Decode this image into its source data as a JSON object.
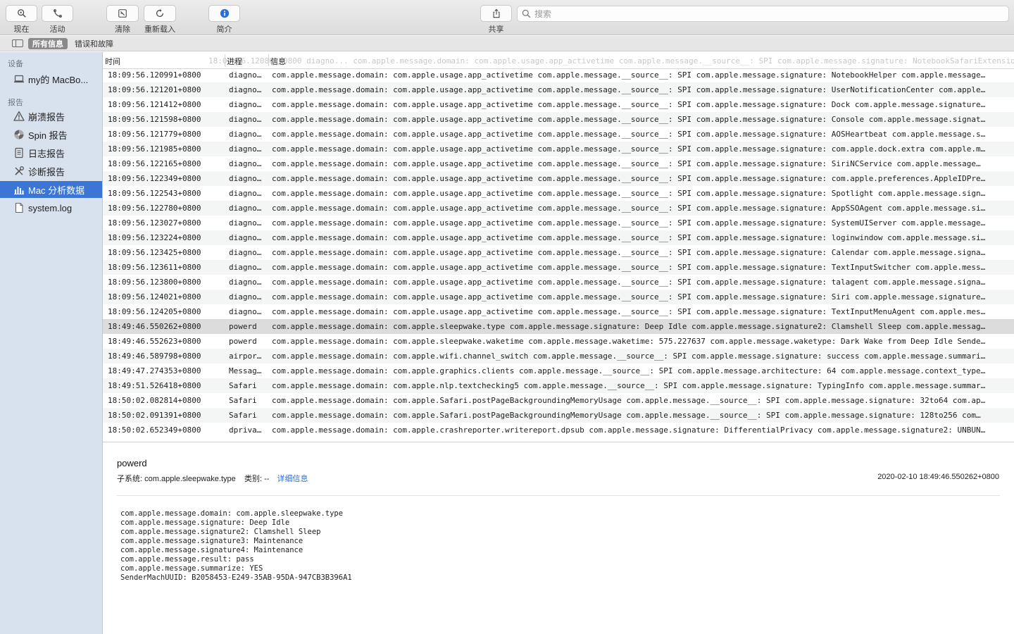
{
  "toolbar": {
    "now_label": "现在",
    "activity_label": "活动",
    "clear_label": "清除",
    "reload_label": "重新载入",
    "info_label": "简介",
    "share_label": "共享",
    "search_placeholder": "搜索"
  },
  "filterbar": {
    "all_label": "所有信息",
    "errors_label": "错误和故障"
  },
  "sidebar": {
    "devices_heading": "设备",
    "device_name": "my的 MacBo...",
    "reports_heading": "报告",
    "items": [
      {
        "label": "崩溃报告",
        "icon": "warning-icon"
      },
      {
        "label": "Spin 报告",
        "icon": "spin-icon"
      },
      {
        "label": "日志报告",
        "icon": "log-icon"
      },
      {
        "label": "诊断报告",
        "icon": "tools-icon"
      },
      {
        "label": "Mac 分析数据",
        "icon": "chart-icon"
      },
      {
        "label": "system.log",
        "icon": "document-icon"
      }
    ],
    "selected_index": 4
  },
  "table": {
    "headers": {
      "time": "时间",
      "process": "进程",
      "message": "信息"
    },
    "ghost_row": "18:09:56.120800+0800  diagno...  com.apple.message.domain: com.apple.usage.app_activetime com.apple.message.__source__: SPI com.apple.message.signature: NotebookSafariExtension com.appl...",
    "rows": [
      {
        "time": "18:09:56.120991+0800",
        "process": "diagno…",
        "message": "com.apple.message.domain: com.apple.usage.app_activetime com.apple.message.__source__: SPI com.apple.message.signature: NotebookHelper com.apple.message…"
      },
      {
        "time": "18:09:56.121201+0800",
        "process": "diagno…",
        "message": "com.apple.message.domain: com.apple.usage.app_activetime com.apple.message.__source__: SPI com.apple.message.signature: UserNotificationCenter com.apple…"
      },
      {
        "time": "18:09:56.121412+0800",
        "process": "diagno…",
        "message": "com.apple.message.domain: com.apple.usage.app_activetime com.apple.message.__source__: SPI com.apple.message.signature: Dock com.apple.message.signature…"
      },
      {
        "time": "18:09:56.121598+0800",
        "process": "diagno…",
        "message": "com.apple.message.domain: com.apple.usage.app_activetime com.apple.message.__source__: SPI com.apple.message.signature: Console com.apple.message.signat…"
      },
      {
        "time": "18:09:56.121779+0800",
        "process": "diagno…",
        "message": "com.apple.message.domain: com.apple.usage.app_activetime com.apple.message.__source__: SPI com.apple.message.signature: AOSHeartbeat com.apple.message.s…"
      },
      {
        "time": "18:09:56.121985+0800",
        "process": "diagno…",
        "message": "com.apple.message.domain: com.apple.usage.app_activetime com.apple.message.__source__: SPI com.apple.message.signature: com.apple.dock.extra com.apple.m…"
      },
      {
        "time": "18:09:56.122165+0800",
        "process": "diagno…",
        "message": "com.apple.message.domain: com.apple.usage.app_activetime com.apple.message.__source__: SPI com.apple.message.signature: SiriNCService com.apple.message…"
      },
      {
        "time": "18:09:56.122349+0800",
        "process": "diagno…",
        "message": "com.apple.message.domain: com.apple.usage.app_activetime com.apple.message.__source__: SPI com.apple.message.signature: com.apple.preferences.AppleIDPre…"
      },
      {
        "time": "18:09:56.122543+0800",
        "process": "diagno…",
        "message": "com.apple.message.domain: com.apple.usage.app_activetime com.apple.message.__source__: SPI com.apple.message.signature: Spotlight com.apple.message.sign…"
      },
      {
        "time": "18:09:56.122780+0800",
        "process": "diagno…",
        "message": "com.apple.message.domain: com.apple.usage.app_activetime com.apple.message.__source__: SPI com.apple.message.signature: AppSSOAgent com.apple.message.si…"
      },
      {
        "time": "18:09:56.123027+0800",
        "process": "diagno…",
        "message": "com.apple.message.domain: com.apple.usage.app_activetime com.apple.message.__source__: SPI com.apple.message.signature: SystemUIServer com.apple.message…"
      },
      {
        "time": "18:09:56.123224+0800",
        "process": "diagno…",
        "message": "com.apple.message.domain: com.apple.usage.app_activetime com.apple.message.__source__: SPI com.apple.message.signature: loginwindow com.apple.message.si…"
      },
      {
        "time": "18:09:56.123425+0800",
        "process": "diagno…",
        "message": "com.apple.message.domain: com.apple.usage.app_activetime com.apple.message.__source__: SPI com.apple.message.signature: Calendar com.apple.message.signa…"
      },
      {
        "time": "18:09:56.123611+0800",
        "process": "diagno…",
        "message": "com.apple.message.domain: com.apple.usage.app_activetime com.apple.message.__source__: SPI com.apple.message.signature: TextInputSwitcher com.apple.mess…"
      },
      {
        "time": "18:09:56.123800+0800",
        "process": "diagno…",
        "message": "com.apple.message.domain: com.apple.usage.app_activetime com.apple.message.__source__: SPI com.apple.message.signature: talagent com.apple.message.signa…"
      },
      {
        "time": "18:09:56.124021+0800",
        "process": "diagno…",
        "message": "com.apple.message.domain: com.apple.usage.app_activetime com.apple.message.__source__: SPI com.apple.message.signature: Siri com.apple.message.signature…"
      },
      {
        "time": "18:09:56.124205+0800",
        "process": "diagno…",
        "message": "com.apple.message.domain: com.apple.usage.app_activetime com.apple.message.__source__: SPI com.apple.message.signature: TextInputMenuAgent com.apple.mes…"
      },
      {
        "time": "18:49:46.550262+0800",
        "process": "powerd",
        "message": "com.apple.message.domain: com.apple.sleepwake.type com.apple.message.signature: Deep Idle com.apple.message.signature2: Clamshell Sleep com.apple.messag…"
      },
      {
        "time": "18:49:46.552623+0800",
        "process": "powerd",
        "message": "com.apple.message.domain: com.apple.sleepwake.waketime com.apple.message.waketime: 575.227637 com.apple.message.waketype: Dark Wake from Deep Idle Sende…"
      },
      {
        "time": "18:49:46.589798+0800",
        "process": "airpor…",
        "message": "com.apple.message.domain: com.apple.wifi.channel_switch com.apple.message.__source__: SPI com.apple.message.signature: success com.apple.message.summari…"
      },
      {
        "time": "18:49:47.274353+0800",
        "process": "Messag…",
        "message": "com.apple.message.domain: com.apple.graphics.clients com.apple.message.__source__: SPI com.apple.message.architecture: 64 com.apple.message.context_type…"
      },
      {
        "time": "18:49:51.526418+0800",
        "process": "Safari",
        "message": "com.apple.message.domain: com.apple.nlp.textchecking5 com.apple.message.__source__: SPI com.apple.message.signature: TypingInfo com.apple.message.summar…"
      },
      {
        "time": "18:50:02.082814+0800",
        "process": "Safari",
        "message": "com.apple.message.domain: com.apple.Safari.postPageBackgroundingMemoryUsage com.apple.message.__source__: SPI com.apple.message.signature: 32to64 com.ap…"
      },
      {
        "time": "18:50:02.091391+0800",
        "process": "Safari",
        "message": "com.apple.message.domain: com.apple.Safari.postPageBackgroundingMemoryUsage com.apple.message.__source__: SPI com.apple.message.signature: 128to256 com…"
      },
      {
        "time": "18:50:02.652349+0800",
        "process": "dpriva…",
        "message": "com.apple.message.domain: com.apple.crashreporter.writereport.dpsub com.apple.message.signature: DifferentialPrivacy com.apple.message.signature2: UNBUN…"
      }
    ],
    "selected_index": 17
  },
  "detail": {
    "process": "powerd",
    "subsystem_label": "子系统:",
    "subsystem": "com.apple.sleepwake.type",
    "category_label": "类别:",
    "category": "--",
    "details_link": "详细信息",
    "date": "2020-02-10 18:49:46.550262+0800",
    "body_lines": [
      "com.apple.message.domain: com.apple.sleepwake.type",
      "com.apple.message.signature: Deep Idle",
      "com.apple.message.signature2: Clamshell Sleep",
      "com.apple.message.signature3: Maintenance",
      "com.apple.message.signature4: Maintenance",
      "com.apple.message.result: pass",
      "com.apple.message.summarize: YES",
      "SenderMachUUID: B2058453-E249-35AB-95DA-947CB3B396A1"
    ]
  }
}
